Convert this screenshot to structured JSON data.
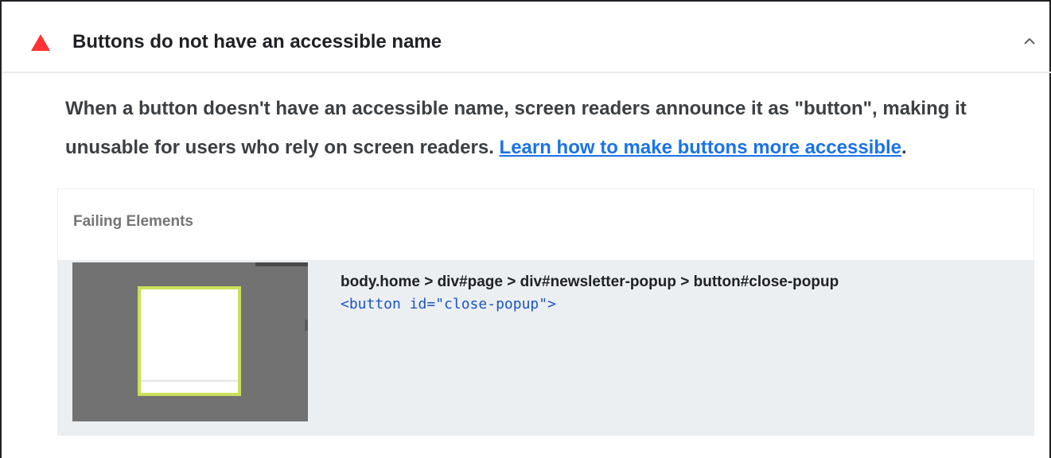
{
  "audit": {
    "title": "Buttons do not have an accessible name",
    "status": "fail",
    "status_color": "#ff3333",
    "status_icon": "triangle-fail-icon",
    "toggle_icon": "chevron-up-icon",
    "description_text": "When a button doesn't have an accessible name, screen readers announce it as \"button\", making it unusable for users who rely on screen readers. ",
    "learn_more_link": "Learn how to make buttons more accessible",
    "description_end": "."
  },
  "details": {
    "header": "Failing Elements",
    "items": [
      {
        "selector": "body.home > div#page > div#newsletter-popup > button#close-popup",
        "snippet": "<button id=\"close-popup\">"
      }
    ]
  },
  "colors": {
    "link": "#1a73e8",
    "snippet": "#1a55c2",
    "row_background": "#eceff2",
    "highlight": "#cbe05a"
  }
}
